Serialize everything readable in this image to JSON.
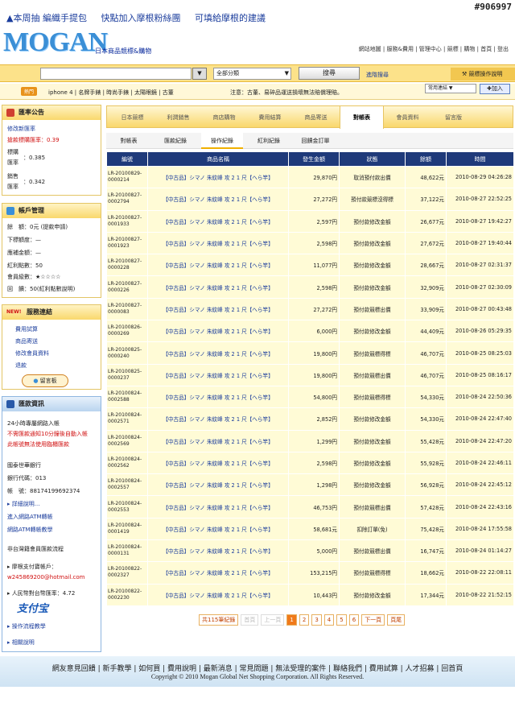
{
  "watermark": "#906997",
  "promo": {
    "items": [
      "▲本周抽 編織手提包",
      "快點加入摩根粉絲團",
      "可填給摩根的建議"
    ]
  },
  "logo": {
    "text": "MOGAN",
    "tagline": "日本商品競標&購物"
  },
  "top_links": "網站地圖 | 服務&費用 | 管理中心 | 競標 | 購物 | 首頁 | 登出",
  "search": {
    "value": "",
    "category": "全部分類",
    "button": "搜尋",
    "advanced": "進階搜尋",
    "bid_help": "競標操作說明"
  },
  "hot": {
    "badge": "熱門",
    "links": "iphone 4 | 名牌手錶 | 時尚手錶 | 太陽眼鏡 | 古董",
    "notice": "注意：古董、易碎品運送損壞無法賠償理賠。",
    "quick_select": "常用連結",
    "add": "加入"
  },
  "sidebar": {
    "rate": {
      "title": "匯率公告",
      "link": "修改新匯率",
      "bid_rate": "搶款標購匯率：0.39",
      "rate1_label": "標購\n匯率",
      "rate1": "：0.385",
      "rate2_label": "銷售\n匯率",
      "rate2": "：0.342"
    },
    "account": {
      "title": "帳戶管理",
      "lines": [
        "餘　額：0元 (提款申請)",
        "下標額度：—",
        "應補金額：—",
        "紅利點數：50",
        "會員級數：★☆☆☆☆",
        "回　饋：50(紅利點數說明)"
      ]
    },
    "service": {
      "title": "服務連結",
      "badge": "NEW!",
      "links": [
        "費用試算",
        "商品寄送",
        "修改會員資料",
        "退款"
      ],
      "msg_btn": "留言板"
    },
    "remit": {
      "title": "匯款資訊",
      "lines": [
        "24小時專屬網路入帳",
        "不需匯款通知10分鐘後自動入帳",
        "此帳號無法使用臨櫃匯款",
        "國泰世華銀行",
        "銀行代碼：013",
        "帳　號：88174199692374",
        "詳細說明...",
        "進入網路ATM轉帳",
        "網路ATM轉帳教學",
        "非台灣籍會員匯款流程",
        "摩根支付寶帳戶：",
        "w245869200@hotmail.com",
        "人民幣對台幣匯率：4.72",
        "支付宝",
        "操作流程教學",
        "相關說明"
      ]
    }
  },
  "tabs": [
    "日本競標",
    "利潤銷售",
    "商店購物",
    "費用結算",
    "商品寄送",
    "對帳表",
    "會員資料",
    "留言版"
  ],
  "subtabs": [
    "對帳表",
    "匯款紀錄",
    "操作紀錄",
    "紅利紀錄",
    "回饋金訂單"
  ],
  "table": {
    "headers": [
      "編號",
      "商品名稱",
      "發生金額",
      "狀態",
      "餘額",
      "時間"
    ],
    "rows": [
      [
        "LR-20100829-0000214",
        "【中古品】シマノ 朱紋峰 攻 2 1 尺【へら竿】",
        "29,870円",
        "取消預付款出價",
        "48,622元",
        "2010-08-29 04:26:28"
      ],
      [
        "LR-20100827-0002794",
        "【中古品】シマノ 朱紋峰 攻 2 1 尺【へら竿】",
        "27,272円",
        "預付款競標沒得標",
        "37,122元",
        "2010-08-27 22:52:25"
      ],
      [
        "LR-20100827-0001933",
        "【中古品】シマノ 朱紋峰 攻 2 1 尺【へら竿】",
        "2,597円",
        "預付款修改金額",
        "26,677元",
        "2010-08-27 19:42:27"
      ],
      [
        "LR-20100827-0001923",
        "【中古品】シマノ 朱紋峰 攻 2 1 尺【へら竿】",
        "2,598円",
        "預付款修改金額",
        "27,672元",
        "2010-08-27 19:40:44"
      ],
      [
        "LR-20100827-0000228",
        "【中古品】シマノ 朱紋峰 攻 2 1 尺【へら竿】",
        "11,077円",
        "預付款修改金額",
        "28,667元",
        "2010-08-27 02:31:37"
      ],
      [
        "LR-20100827-0000226",
        "【中古品】シマノ 朱紋峰 攻 2 1 尺【へら竿】",
        "2,598円",
        "預付款修改金額",
        "32,909元",
        "2010-08-27 02:30:09"
      ],
      [
        "LR-20100827-0000083",
        "【中古品】シマノ 朱紋峰 攻 2 1 尺【へら竿】",
        "27,272円",
        "預付款競標出價",
        "33,909元",
        "2010-08-27 00:43:48"
      ],
      [
        "LR-20100826-0000269",
        "【中古品】シマノ 朱紋峰 攻 2 1 尺【へら竿】",
        "6,000円",
        "預付款修改金額",
        "44,409元",
        "2010-08-26 05:29:35"
      ],
      [
        "LR-20100825-0000240",
        "【中古品】シマノ 朱紋峰 攻 2 1 尺【へら竿】",
        "19,800円",
        "預付款競標得標",
        "46,707元",
        "2010-08-25 08:25:03"
      ],
      [
        "LR-20100825-0000237",
        "【中古品】シマノ 朱紋峰 攻 2 1 尺【へら竿】",
        "19,800円",
        "預付款競標出價",
        "46,707元",
        "2010-08-25 08:16:17"
      ],
      [
        "LR-20100824-0002588",
        "【中古品】シマノ 朱紋峰 攻 2 1 尺【へら竿】",
        "54,800円",
        "預付款競標得標",
        "54,330元",
        "2010-08-24 22:50:36"
      ],
      [
        "LR-20100824-0002571",
        "【中古品】シマノ 朱紋峰 攻 2 1 尺【へら竿】",
        "2,852円",
        "預付款修改金額",
        "54,330元",
        "2010-08-24 22:47:40"
      ],
      [
        "LR-20100824-0002569",
        "【中古品】シマノ 朱紋峰 攻 2 1 尺【へら竿】",
        "1,299円",
        "預付款修改金額",
        "55,428元",
        "2010-08-24 22:47:20"
      ],
      [
        "LR-20100824-0002562",
        "【中古品】シマノ 朱紋峰 攻 2 1 尺【へら竿】",
        "2,598円",
        "預付款修改金額",
        "55,928元",
        "2010-08-24 22:46:11"
      ],
      [
        "LR-20100824-0002557",
        "【中古品】シマノ 朱紋峰 攻 2 1 尺【へら竿】",
        "1,298円",
        "預付款修改金額",
        "56,928元",
        "2010-08-24 22:45:12"
      ],
      [
        "LR-20100824-0002553",
        "【中古品】シマノ 朱紋峰 攻 2 1 尺【へら竿】",
        "46,753円",
        "預付款競標出價",
        "57,428元",
        "2010-08-24 22:43:16"
      ],
      [
        "LR-20100824-0001419",
        "【中古品】シマノ 朱紋峰 攻 2 1 尺【へら竿】",
        "58,681元",
        "扣除訂單(免)",
        "75,428元",
        "2010-08-24 17:55:58"
      ],
      [
        "LR-20100824-0000131",
        "【中古品】シマノ 朱紋峰 攻 2 1 尺【へら竿】",
        "5,000円",
        "預付款競標出價",
        "16,747元",
        "2010-08-24 01:14:27"
      ],
      [
        "LR-20100822-0002327",
        "【中古品】シマノ 朱紋峰 攻 2 1 尺【へら竿】",
        "153,215円",
        "預付款競標得標",
        "18,662元",
        "2010-08-22 22:08:11"
      ],
      [
        "LR-20100822-0002230",
        "【中古品】シマノ 朱紋峰 攻 2 1 尺【へら竿】",
        "10,443円",
        "預付款修改金額",
        "17,344元",
        "2010-08-22 21:52:15"
      ]
    ]
  },
  "pager": {
    "total": "共115筆紀錄",
    "first": "首頁",
    "prev": "上一頁",
    "pages": [
      "1",
      "2",
      "3",
      "4",
      "5",
      "6"
    ],
    "next": "下一頁",
    "last": "頁尾"
  },
  "footer": {
    "links": "網友意見回饋 | 新手教學 | 如何買 | 費用說明 | 最新消息 | 常見問題 | 無法受理的案件 | 聯絡我們 | 費用試算 | 人才招募 | 回首頁",
    "copyright": "Copyright © 2010 Mogan Global Net Shopping Corporation. All Rights Reserved."
  }
}
